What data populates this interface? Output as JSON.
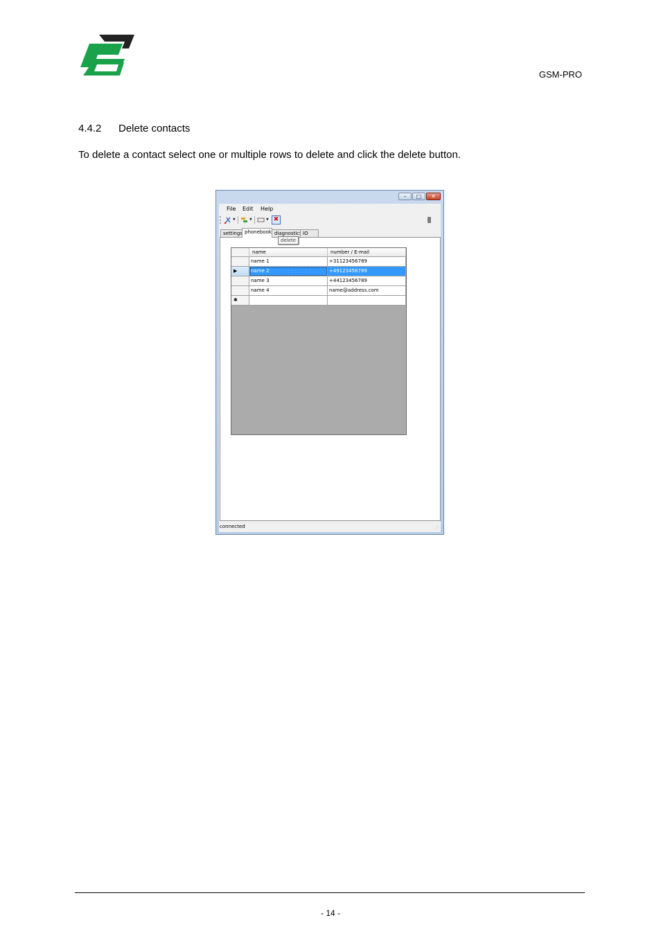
{
  "header": {
    "doc_id": "GSM-PRO",
    "brand_colors": {
      "primary": "#1aa24b",
      "secondary": "#222222"
    }
  },
  "section": {
    "number": "4.4.2",
    "title": "Delete contacts",
    "body": "To delete a contact select one or multiple rows to delete and click the delete button."
  },
  "app": {
    "menu": [
      "File",
      "Edit",
      "Help"
    ],
    "caption_buttons": {
      "minimize": "–",
      "maximize": "□",
      "close": "✕"
    },
    "toolbar_icons": [
      "connect-icon",
      "sync-icon",
      "card-icon",
      "delete-icon",
      "plug-icon"
    ],
    "tabs": [
      "settings",
      "phonebook",
      "diagnostics",
      "IO"
    ],
    "active_tab": "phonebook",
    "tooltip": "delete",
    "columns": [
      "name",
      "number / E-mail"
    ],
    "rows": [
      {
        "marker": "",
        "name": "name 1",
        "number": "+31123456789"
      },
      {
        "marker": "▶",
        "name": "name 2",
        "number": "+49123456789"
      },
      {
        "marker": "",
        "name": "name 3",
        "number": "+44123456789"
      },
      {
        "marker": "",
        "name": "name 4",
        "number": "name@address.com"
      }
    ],
    "new_row_marker": "✱",
    "selection_color": "#3399ff",
    "status": "connected"
  },
  "footer": {
    "page_number": "- 14 -"
  }
}
